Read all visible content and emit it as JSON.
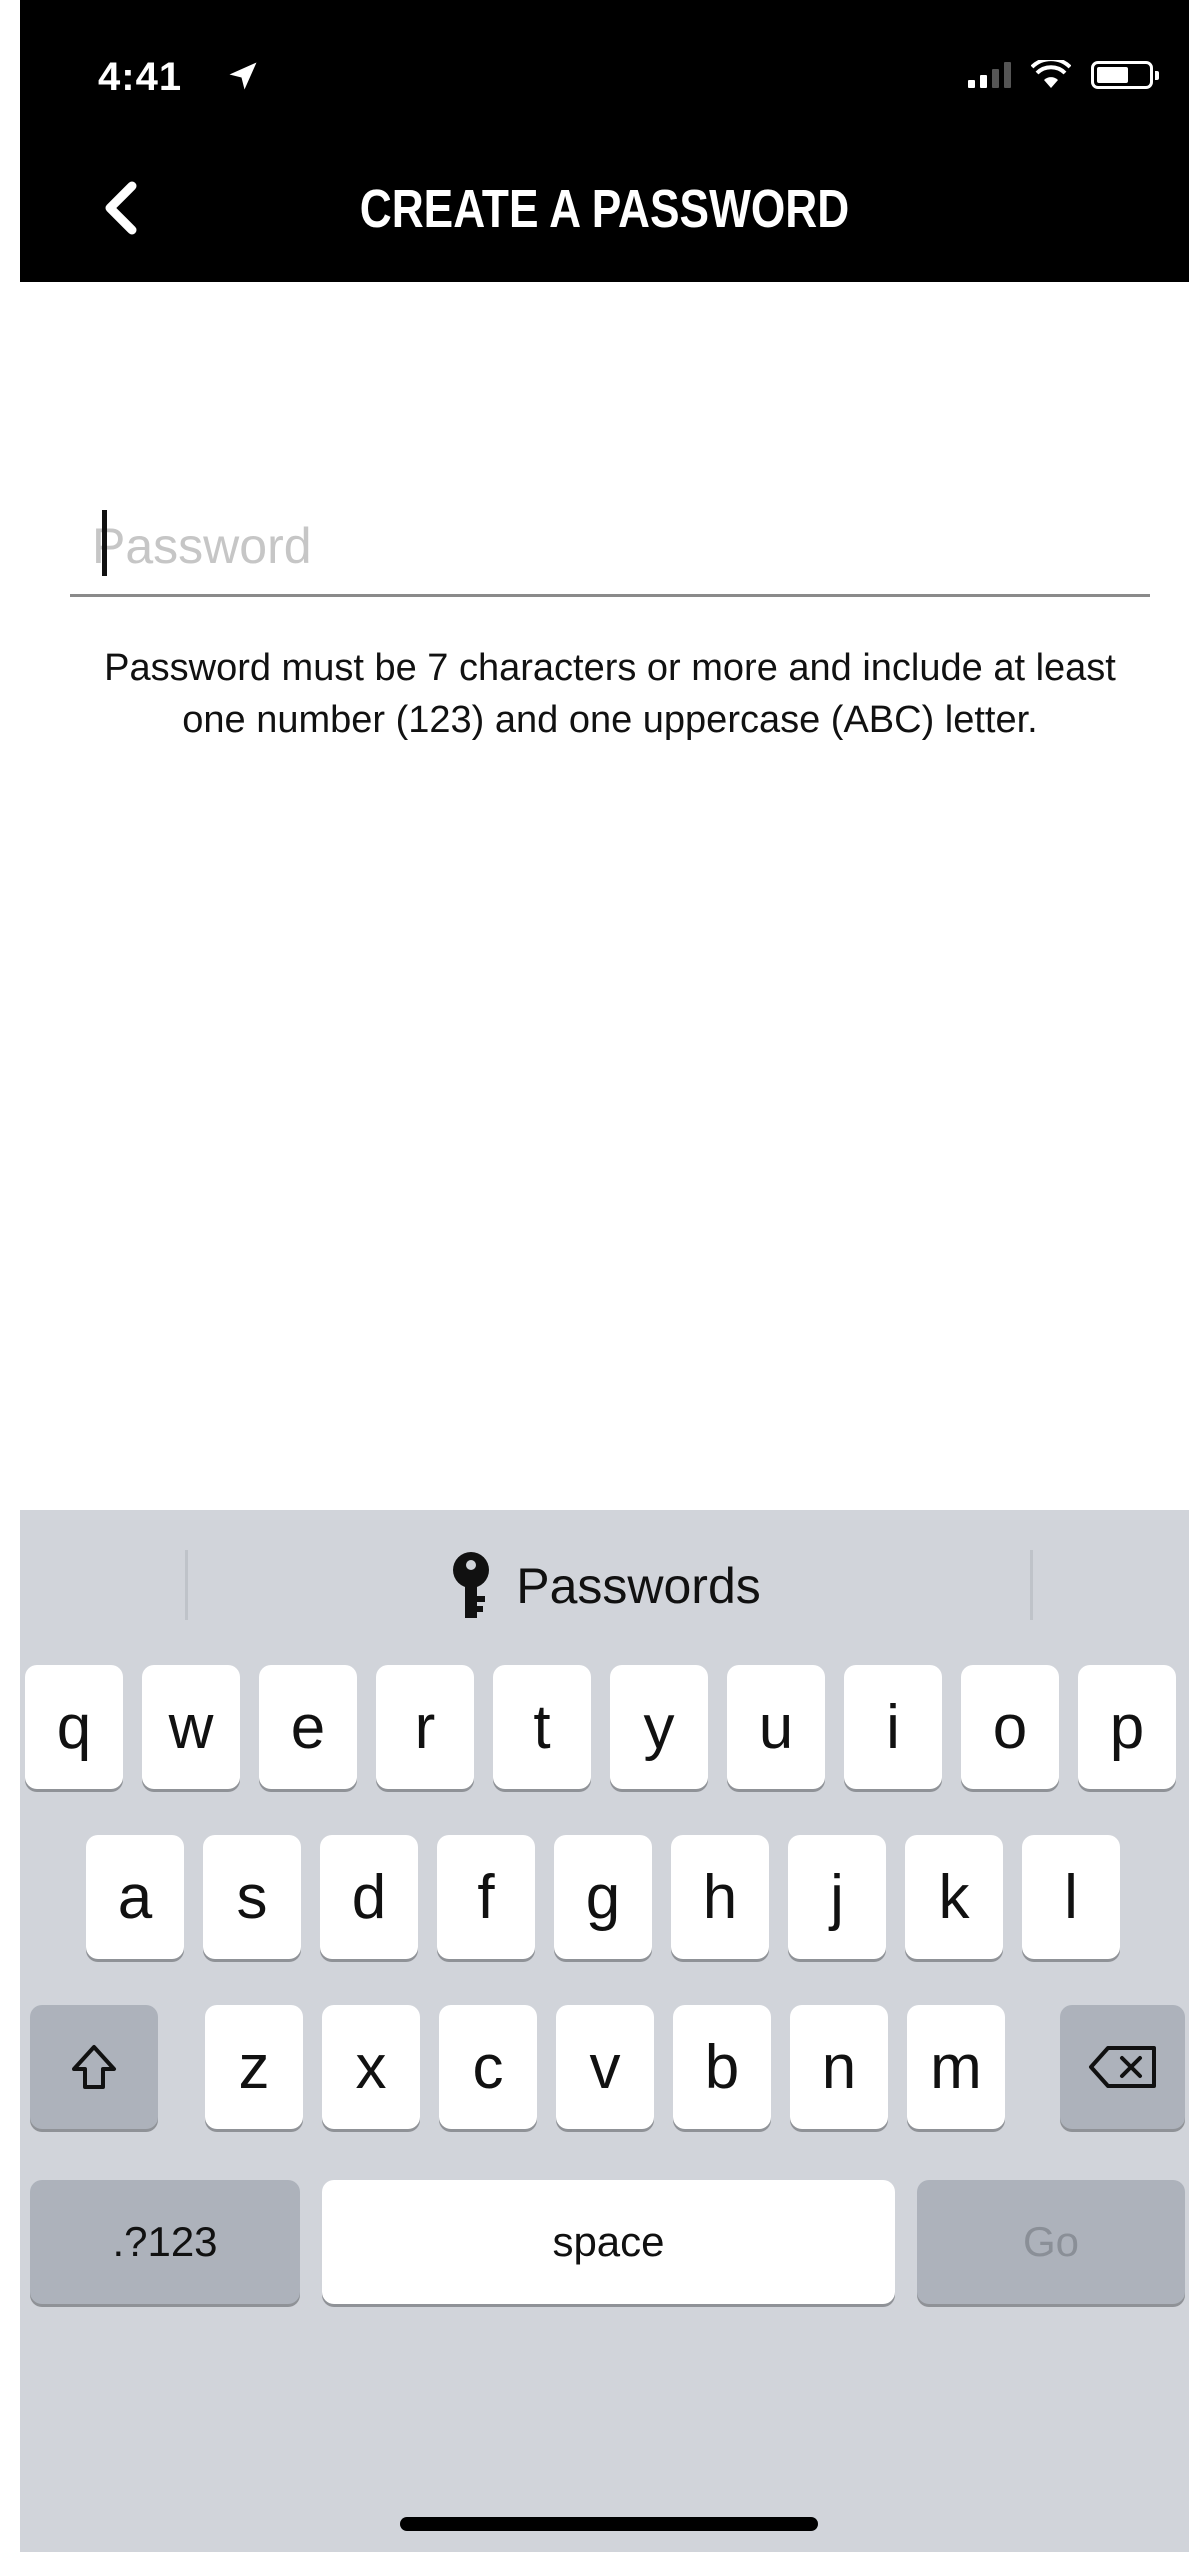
{
  "status_bar": {
    "time": "4:41"
  },
  "header": {
    "title": "CREATE A PASSWORD"
  },
  "form": {
    "password_placeholder": "Password",
    "password_value": "",
    "hint": "Password must be 7 characters or more and include at least one number (123) and one uppercase (ABC) letter."
  },
  "keyboard": {
    "suggestion_label": "Passwords",
    "row1": [
      "q",
      "w",
      "e",
      "r",
      "t",
      "y",
      "u",
      "i",
      "o",
      "p"
    ],
    "row2": [
      "a",
      "s",
      "d",
      "f",
      "g",
      "h",
      "j",
      "k",
      "l"
    ],
    "row3": [
      "z",
      "x",
      "c",
      "v",
      "b",
      "n",
      "m"
    ],
    "numbers_key": ".?123",
    "space_key": "space",
    "go_key": "Go"
  },
  "colors": {
    "header_bg": "#000000",
    "keyboard_bg": "#d1d4da",
    "key_bg": "#ffffff",
    "key_dark_bg": "#adb2bb"
  }
}
